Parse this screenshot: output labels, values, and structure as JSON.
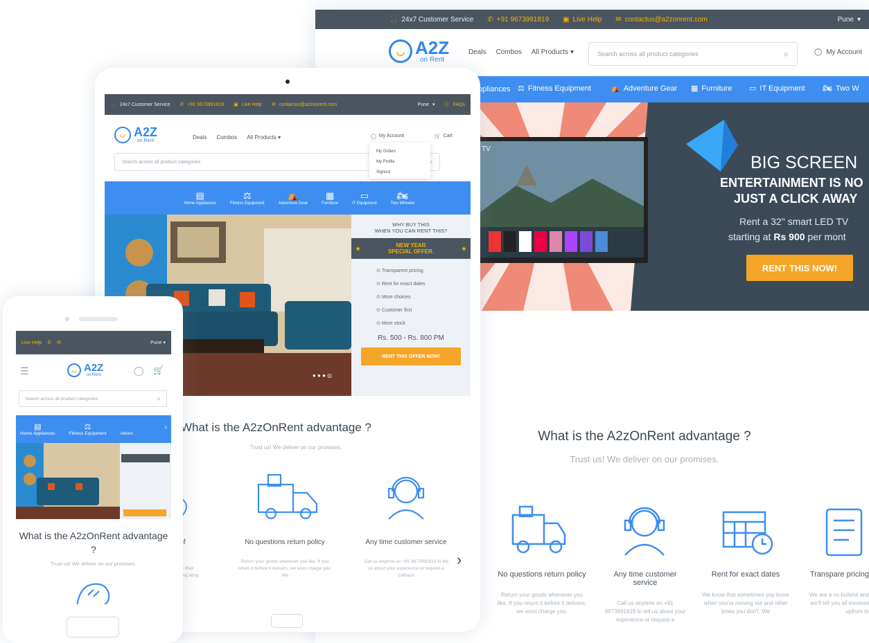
{
  "desktop": {
    "topbar": {
      "customer_service": "24x7 Customer Service",
      "phone": "+91 9673991819",
      "live_help": "Live Help",
      "email": "contactus@a2zonrent.com",
      "city": "Pune"
    },
    "logo": {
      "brand": "A2Z",
      "tagline": "on Rent"
    },
    "nav": {
      "deals": "Deals",
      "combos": "Combos",
      "all_products": "All Products"
    },
    "search_placeholder": "Search across all product categories",
    "my_account": "My Account",
    "categories": [
      "ppliances",
      "Fitness Equipment",
      "Adventure Gear",
      "Furniture",
      "IT Equipment",
      "Two W"
    ],
    "hero": {
      "tv_label": "TV",
      "title": "BIG SCREEN",
      "line2": "ENTERTAINMENT IS NO",
      "line3": "JUST A CLICK AWAY",
      "offer1": "Rent a 32\" smart LED TV",
      "offer2_pre": "starting at ",
      "offer2_price": "Rs 900",
      "offer2_post": " per mont",
      "cta": "RENT THIS NOW!"
    },
    "advantage": {
      "title": "What is the A2zOnRent advantage ?",
      "subtitle": "Trust us! We deliver on our promises."
    },
    "features": [
      {
        "title": "No questions return policy",
        "body": "Return your goods whenever you like. If you return it before it delivers, we wont charge you."
      },
      {
        "title": "Any time customer service",
        "body": "Call us anytime on +91 9673991819 to tell us about your experience or request a"
      },
      {
        "title": "Rent for exact dates",
        "body": "We know that sometimes you know when you're moving out and other times you don't. We"
      },
      {
        "title": "Transpare pricing",
        "body": "We are a no bullshit and we'll tell you all involved upfront to"
      }
    ]
  },
  "tablet": {
    "topbar": {
      "customer_service": "24x7 Customer Service",
      "phone": "+91 9673991819",
      "live_help": "Live Help",
      "email": "contactus@a2zonrent.com",
      "city": "Pune",
      "faqs": "FAQs"
    },
    "nav": {
      "deals": "Deals",
      "combos": "Combos",
      "all_products": "All Products"
    },
    "my_account": "My Account",
    "cart": "Cart",
    "account_menu": [
      "My Orders",
      "My Profile",
      "Signout"
    ],
    "search_placeholder": "Search across all product categories",
    "categories": [
      "Home Appliances",
      "Fitness Equipment",
      "Adventure Gear",
      "Furniture",
      "IT Equipment",
      "Two Wheeler"
    ],
    "hero": {
      "why_buy": "WHY BUY THIS",
      "when_rent": "WHEN YOU CAN RENT THIS?",
      "offer_line1": "NEW YEAR",
      "offer_line2": "SPECIAL OFFER.",
      "benefits": [
        "Transparent pricing",
        "Rent for exact dates",
        "More choices",
        "Customer first",
        "More stock"
      ],
      "price": "Rs. 500 - Rs. 800 PM",
      "cta": "RENT THIS OFFER NOW!"
    },
    "advantage": {
      "title": "What is the A2zOnRent advantage ?",
      "subtitle": "Trust us! We deliver on our promises."
    },
    "features": [
      {
        "title": "e of",
        "body": "y our their renting ating our"
      },
      {
        "title": "No questions return policy",
        "body": "Return your goods whenever you like. If you return it before it delivers, we wont charge you. We"
      },
      {
        "title": "Any time customer service",
        "body": "Call us anytime on +91 9673991819 to tell us about your experience or request a callback"
      }
    ],
    "next_arrow": "›"
  },
  "phone": {
    "topbar": {
      "live_help": "Live Help",
      "city": "Pune"
    },
    "search_placeholder": "Search across all product categories",
    "categories": [
      "Home Appliances",
      "Fitness Equipment",
      "Adven"
    ],
    "advantage": {
      "title": "What is the A2zOnRent advantage ?",
      "subtitle": "Trust us! We deliver on our promises."
    }
  },
  "colors": {
    "topbar": "#4a5560",
    "blue": "#3d8ef0",
    "orange": "#f5a528",
    "accent_yellow": "#f4b400"
  }
}
